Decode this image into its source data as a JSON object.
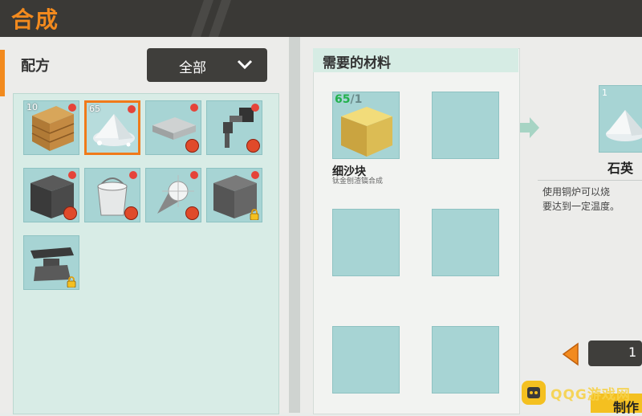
{
  "header": {
    "title": "合成"
  },
  "left": {
    "recipe_label": "配方",
    "filter": {
      "selected": "全部"
    },
    "recipes": [
      {
        "name": "wood-block",
        "count": "10",
        "dot": true,
        "badge": ""
      },
      {
        "name": "quartz-sand",
        "count": "65",
        "dot": true,
        "badge": "",
        "selected": true
      },
      {
        "name": "stone-slab",
        "count": "",
        "dot": true,
        "badge": "unavailable"
      },
      {
        "name": "mechanical-arm",
        "count": "",
        "dot": true,
        "badge": "unavailable"
      },
      {
        "name": "dark-stone-block",
        "count": "",
        "dot": true,
        "badge": "unavailable"
      },
      {
        "name": "bucket",
        "count": "",
        "dot": true,
        "badge": "unavailable"
      },
      {
        "name": "drill",
        "count": "",
        "dot": true,
        "badge": "unavailable"
      },
      {
        "name": "gray-stone-block",
        "count": "",
        "dot": true,
        "badge": "locked"
      },
      {
        "name": "anvil",
        "count": "",
        "dot": false,
        "badge": "locked"
      }
    ]
  },
  "materials": {
    "title": "需要的材料",
    "item": {
      "have": "65",
      "need": "/1",
      "name": "细沙块",
      "note": "钛金刨渣镐合成"
    }
  },
  "result": {
    "count": "1",
    "name": "石英",
    "desc_line1": "使用铜炉可以烧",
    "desc_line2": "要达到一定温度。"
  },
  "quantity": "1",
  "craft_button": "制作",
  "watermark": "QQG游戏网",
  "colors": {
    "accent": "#f28a1e",
    "slot": "#a7d4d4",
    "craft": "#f4c020"
  }
}
